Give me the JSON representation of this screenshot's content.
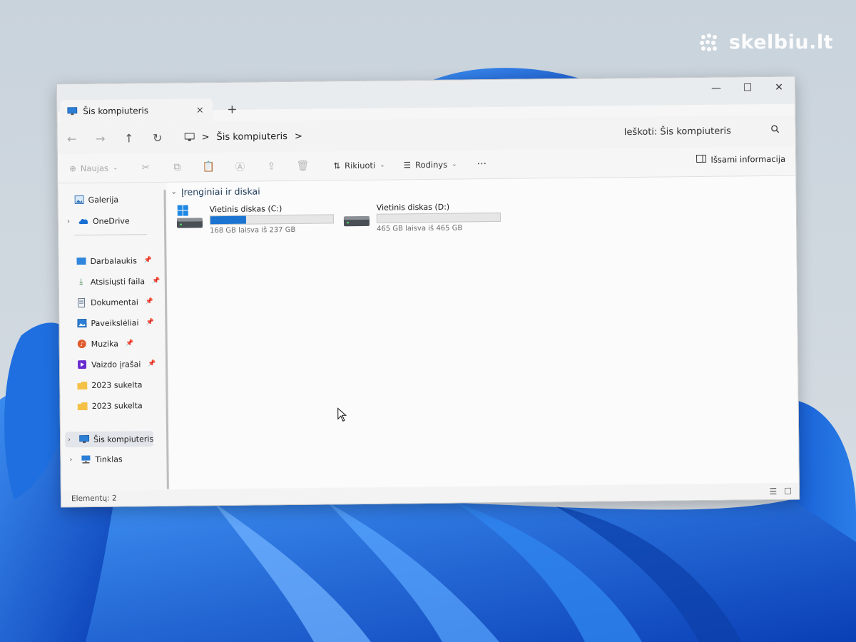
{
  "watermark": {
    "text": "skelbiu.lt"
  },
  "window": {
    "tab_title": "Šis kompiuteris",
    "tab_close": "×",
    "new_tab": "+",
    "controls": {
      "minimize": "—",
      "maximize": "☐",
      "close": "✕"
    }
  },
  "address": {
    "segments": [
      "Šis kompiuteris"
    ],
    "separator": ">",
    "search_placeholder": "Ieškoti: Šis kompiuteris"
  },
  "commandbar": {
    "new_label": "Naujas",
    "sort_label": "Rikiuoti",
    "view_label": "Rodinys",
    "more": "···",
    "details_label": "Išsami informacija"
  },
  "sidebar": {
    "items": [
      {
        "label": "Galerija",
        "icon": "gallery-icon"
      },
      {
        "label": "OneDrive",
        "icon": "onedrive-icon"
      },
      {
        "label": "Darbalaukis",
        "icon": "desktop-icon",
        "pinned": true
      },
      {
        "label": "Atsisiųsti faila",
        "icon": "download-icon",
        "pinned": true
      },
      {
        "label": "Dokumentai",
        "icon": "documents-icon",
        "pinned": true
      },
      {
        "label": "Paveikslėliai",
        "icon": "pictures-icon",
        "pinned": true
      },
      {
        "label": "Muzika",
        "icon": "music-icon",
        "pinned": true
      },
      {
        "label": "Vaizdo įrašai",
        "icon": "videos-icon",
        "pinned": true
      },
      {
        "label": "2023 sukelta",
        "icon": "folder-icon"
      },
      {
        "label": "2023 sukelta",
        "icon": "folder-icon"
      },
      {
        "label": "Šis kompiuteris",
        "icon": "this-pc-icon",
        "selected": true
      },
      {
        "label": "Tinklas",
        "icon": "network-icon"
      }
    ]
  },
  "content": {
    "group_title": "Įrenginiai ir diskai",
    "drives": [
      {
        "name": "Vietinis diskas (C:)",
        "free_text": "168 GB laisva iš 237 GB",
        "used_fraction": 0.29
      },
      {
        "name": "Vietinis diskas (D:)",
        "free_text": "465 GB laisva iš 465 GB",
        "used_fraction": 0.0
      }
    ]
  },
  "status": {
    "items_text": "Elementų: 2"
  },
  "colors": {
    "accent": "#1b74d1"
  }
}
